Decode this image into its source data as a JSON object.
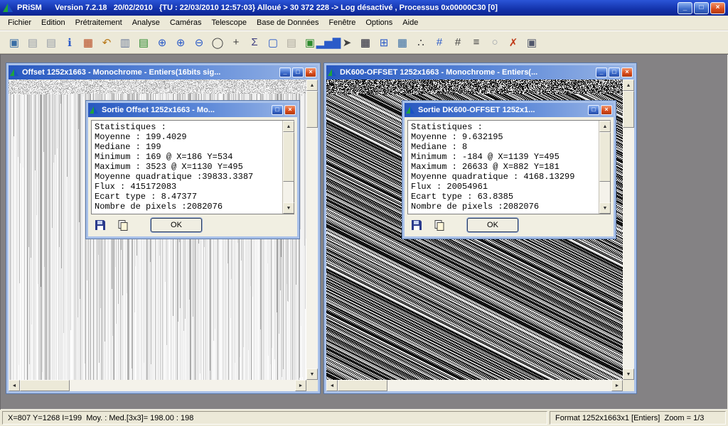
{
  "app": {
    "title": "PRiSM      Version 7.2.18   20/02/2010   {TU : 22/03/2010 12:57:03} Alloué > 30 372 228 -> Log désactivé , Processus 0x00000C30 [0]",
    "minimize": "_",
    "restore": "□",
    "close": "×"
  },
  "menu": {
    "items": [
      "Fichier",
      "Edition",
      "Prétraitement",
      "Analyse",
      "Caméras",
      "Telescope",
      "Base de Données",
      "Fenêtre",
      "Options",
      "Aide"
    ]
  },
  "toolbar": {
    "icons": [
      {
        "name": "open-image-icon",
        "glyph": "▣",
        "color": "#3a6ea5"
      },
      {
        "name": "save-icon",
        "glyph": "▤",
        "color": "#9aa0a8"
      },
      {
        "name": "save-all-icon",
        "glyph": "▤",
        "color": "#9aa0a8"
      },
      {
        "name": "info-icon",
        "glyph": "ℹ",
        "color": "#2a5ac8"
      },
      {
        "name": "stats-icon",
        "glyph": "▦",
        "color": "#b84a20"
      },
      {
        "name": "undo-icon",
        "glyph": "↶",
        "color": "#b87818"
      },
      {
        "name": "copy-icon",
        "glyph": "▥",
        "color": "#6a7a9a"
      },
      {
        "name": "paste-icon",
        "glyph": "▤",
        "color": "#2e8b2e"
      },
      {
        "name": "zoom-window-icon",
        "glyph": "⊕",
        "color": "#2a5ac8"
      },
      {
        "name": "zoom-in-icon",
        "glyph": "⊕",
        "color": "#2a5ac8"
      },
      {
        "name": "zoom-out-icon",
        "glyph": "⊖",
        "color": "#2a5ac8"
      },
      {
        "name": "magnifier-icon",
        "glyph": "◯",
        "color": "#404040"
      },
      {
        "name": "crosshair-icon",
        "glyph": "+",
        "color": "#404040"
      },
      {
        "name": "sigma-icon",
        "glyph": "Σ",
        "color": "#404080"
      },
      {
        "name": "fit-window-icon",
        "glyph": "▢",
        "color": "#2a5ac8"
      },
      {
        "name": "print-icon",
        "glyph": "▤",
        "color": "#b0aca0"
      },
      {
        "name": "clone-window-icon",
        "glyph": "▣",
        "color": "#2e8b2e"
      },
      {
        "name": "histogram-icon",
        "glyph": "▂▅▇",
        "color": "#2a5ac8"
      },
      {
        "name": "telescope-icon",
        "glyph": "➤",
        "color": "#404040"
      },
      {
        "name": "ccd-camera-icon",
        "glyph": "▦",
        "color": "#1a1a2e"
      },
      {
        "name": "tile-windows-icon",
        "glyph": "⊞",
        "color": "#2a5ac8"
      },
      {
        "name": "table-icon",
        "glyph": "▦",
        "color": "#3a6ea5"
      },
      {
        "name": "align-icon",
        "glyph": "∴",
        "color": "#404040"
      },
      {
        "name": "numbers-grid-icon",
        "glyph": "#",
        "color": "#2a5ac8"
      },
      {
        "name": "pixel-grid-icon",
        "glyph": "#",
        "color": "#404040"
      },
      {
        "name": "calculator-icon",
        "glyph": "≡",
        "color": "#404040"
      },
      {
        "name": "settings-icon",
        "glyph": "○",
        "color": "#9aa0a8"
      },
      {
        "name": "delete-icon",
        "glyph": "✗",
        "color": "#c03a18"
      },
      {
        "name": "camera-icon",
        "glyph": "▣",
        "color": "#50566a"
      }
    ]
  },
  "windows": [
    {
      "title": "Offset 1252x1663 - Monochrome - Entiers(16bits sig...",
      "dialog": {
        "title": "Sortie Offset 1252x1663 - Mo...",
        "lines": [
          "Statistiques :",
          "Moyenne : 199.4029",
          "Mediane : 199",
          "Minimum : 169 @ X=186 Y=534",
          "Maximum : 3523 @ X=1130 Y=495",
          "Moyenne quadratique :39833.3387",
          "Flux : 415172083",
          "Ecart type : 8.47377",
          "Nombre de pixels :2082076"
        ],
        "ok_label": "OK"
      }
    },
    {
      "title": "DK600-OFFSET 1252x1663 - Monochrome - Entiers(...",
      "dialog": {
        "title": "Sortie DK600-OFFSET 1252x1...",
        "lines": [
          "Statistiques :",
          "Moyenne : 9.632195",
          "Mediane : 8",
          "Minimum : -184 @ X=1139 Y=495",
          "Maximum : 26633 @ X=882 Y=181",
          "Moyenne quadratique : 4168.13299",
          "Flux : 20054961",
          "Ecart type : 63.8385",
          "Nombre de pixels :2082076"
        ],
        "ok_label": "OK"
      }
    }
  ],
  "statusbar": {
    "left": "X=807 Y=1268 I=199  Moy. : Med.[3x3]= 198.00 : 198",
    "right": "Format 1252x1663x1 [Entiers]  Zoom = 1/3"
  },
  "colors": {
    "titlebar_blue": "#1535ae",
    "child_title_gradient_start": "#2858c0",
    "child_title_gradient_end": "#9ab6e6",
    "close_red": "#d84a1a",
    "mdi_gray": "#848284",
    "face": "#ece9d8"
  },
  "scroll": {
    "up": "▲",
    "down": "▼",
    "left": "◄",
    "right": "►"
  }
}
